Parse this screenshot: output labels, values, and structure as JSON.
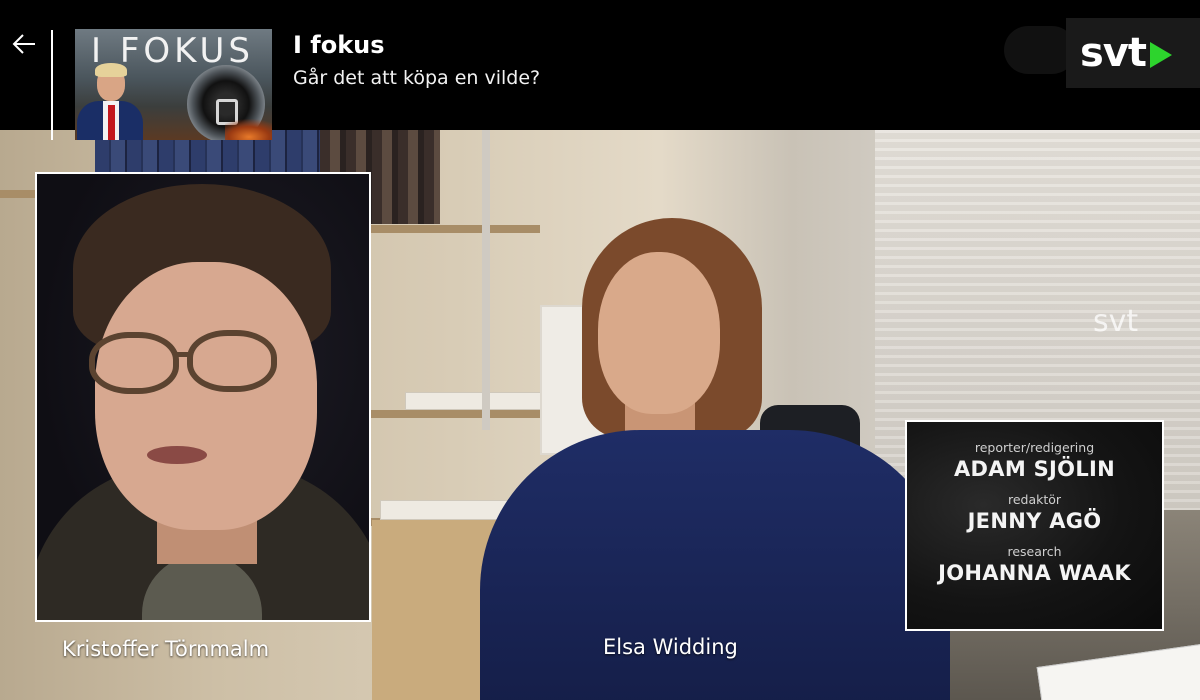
{
  "header": {
    "show_title": "I fokus",
    "episode_title": "Går det att köpa en vilde?",
    "thumbnail_title": "I FOKUS",
    "back_icon": "arrow-left-icon",
    "channel_logo": "svt"
  },
  "video": {
    "watermark": "svt",
    "pip_caption": "Kristoffer Törnmalm",
    "main_caption": "Elsa Widding",
    "credits": [
      {
        "role": "reporter/redigering",
        "name": "ADAM SJÖLIN"
      },
      {
        "role": "redaktör",
        "name": "JENNY AGÖ"
      },
      {
        "role": "research",
        "name": "JOHANNA WAAK"
      }
    ]
  },
  "colors": {
    "logo_play": "#2dd42d",
    "background": "#000000"
  }
}
